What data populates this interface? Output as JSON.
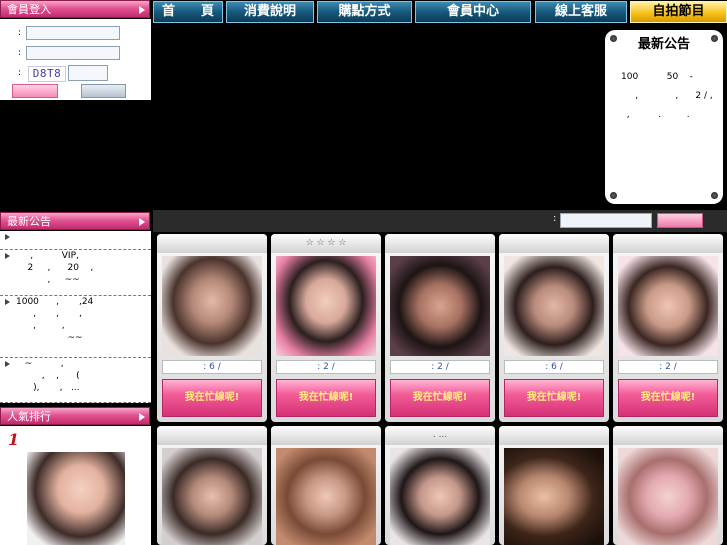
{
  "left": {
    "login_header": "會員登入",
    "login_rows": [
      ":",
      ":",
      ":"
    ],
    "captcha": "D8T8",
    "news_header": "最新公告",
    "news": [
      "",
      "     ,          VIP,\n    2     ,      20    ,\n           ,     ~~",
      "1000      ,       ,24\n      ,       ,       ,\n      ,         ,\n                  ~~",
      "   ~          ,\n         ,    ,      (\n      ),       ,   ..."
    ],
    "rank_header": "人氣排行",
    "rank_no": "1"
  },
  "nav": {
    "items": [
      "首　　頁",
      "消費說明",
      "購點方式",
      "會員中心",
      "線上客服",
      "自拍節目"
    ]
  },
  "announce": {
    "title": "最新公告",
    "text": "100          50    -\n     ,             ,      2 / ,\n  ,          .         ."
  },
  "search": {
    "label": ":"
  },
  "cards": [
    {
      "top": "",
      "meta": ": 6   /",
      "status": "我在忙線呢!"
    },
    {
      "top": "☆   ☆   ☆   ☆",
      "meta": ": 2   /",
      "status": "我在忙線呢!"
    },
    {
      "top": "",
      "meta": ": 2   /",
      "status": "我在忙線呢!"
    },
    {
      "top": "",
      "meta": ": 6   /",
      "status": "我在忙線呢!"
    },
    {
      "top": "",
      "meta": ": 2   /",
      "status": "我在忙線呢!"
    },
    {
      "top": "",
      "meta": "",
      "status": ""
    },
    {
      "top": "",
      "meta": "",
      "status": ""
    },
    {
      "top": ". ...",
      "meta": "",
      "status": ""
    },
    {
      "top": "",
      "meta": "",
      "status": ""
    },
    {
      "top": "",
      "meta": "",
      "status": ""
    }
  ],
  "colors": {
    "pink_header": "#e25492",
    "nav_blue": "#18597c",
    "nav_active": "#f7c21b",
    "busy_pink": "#f25c98"
  }
}
